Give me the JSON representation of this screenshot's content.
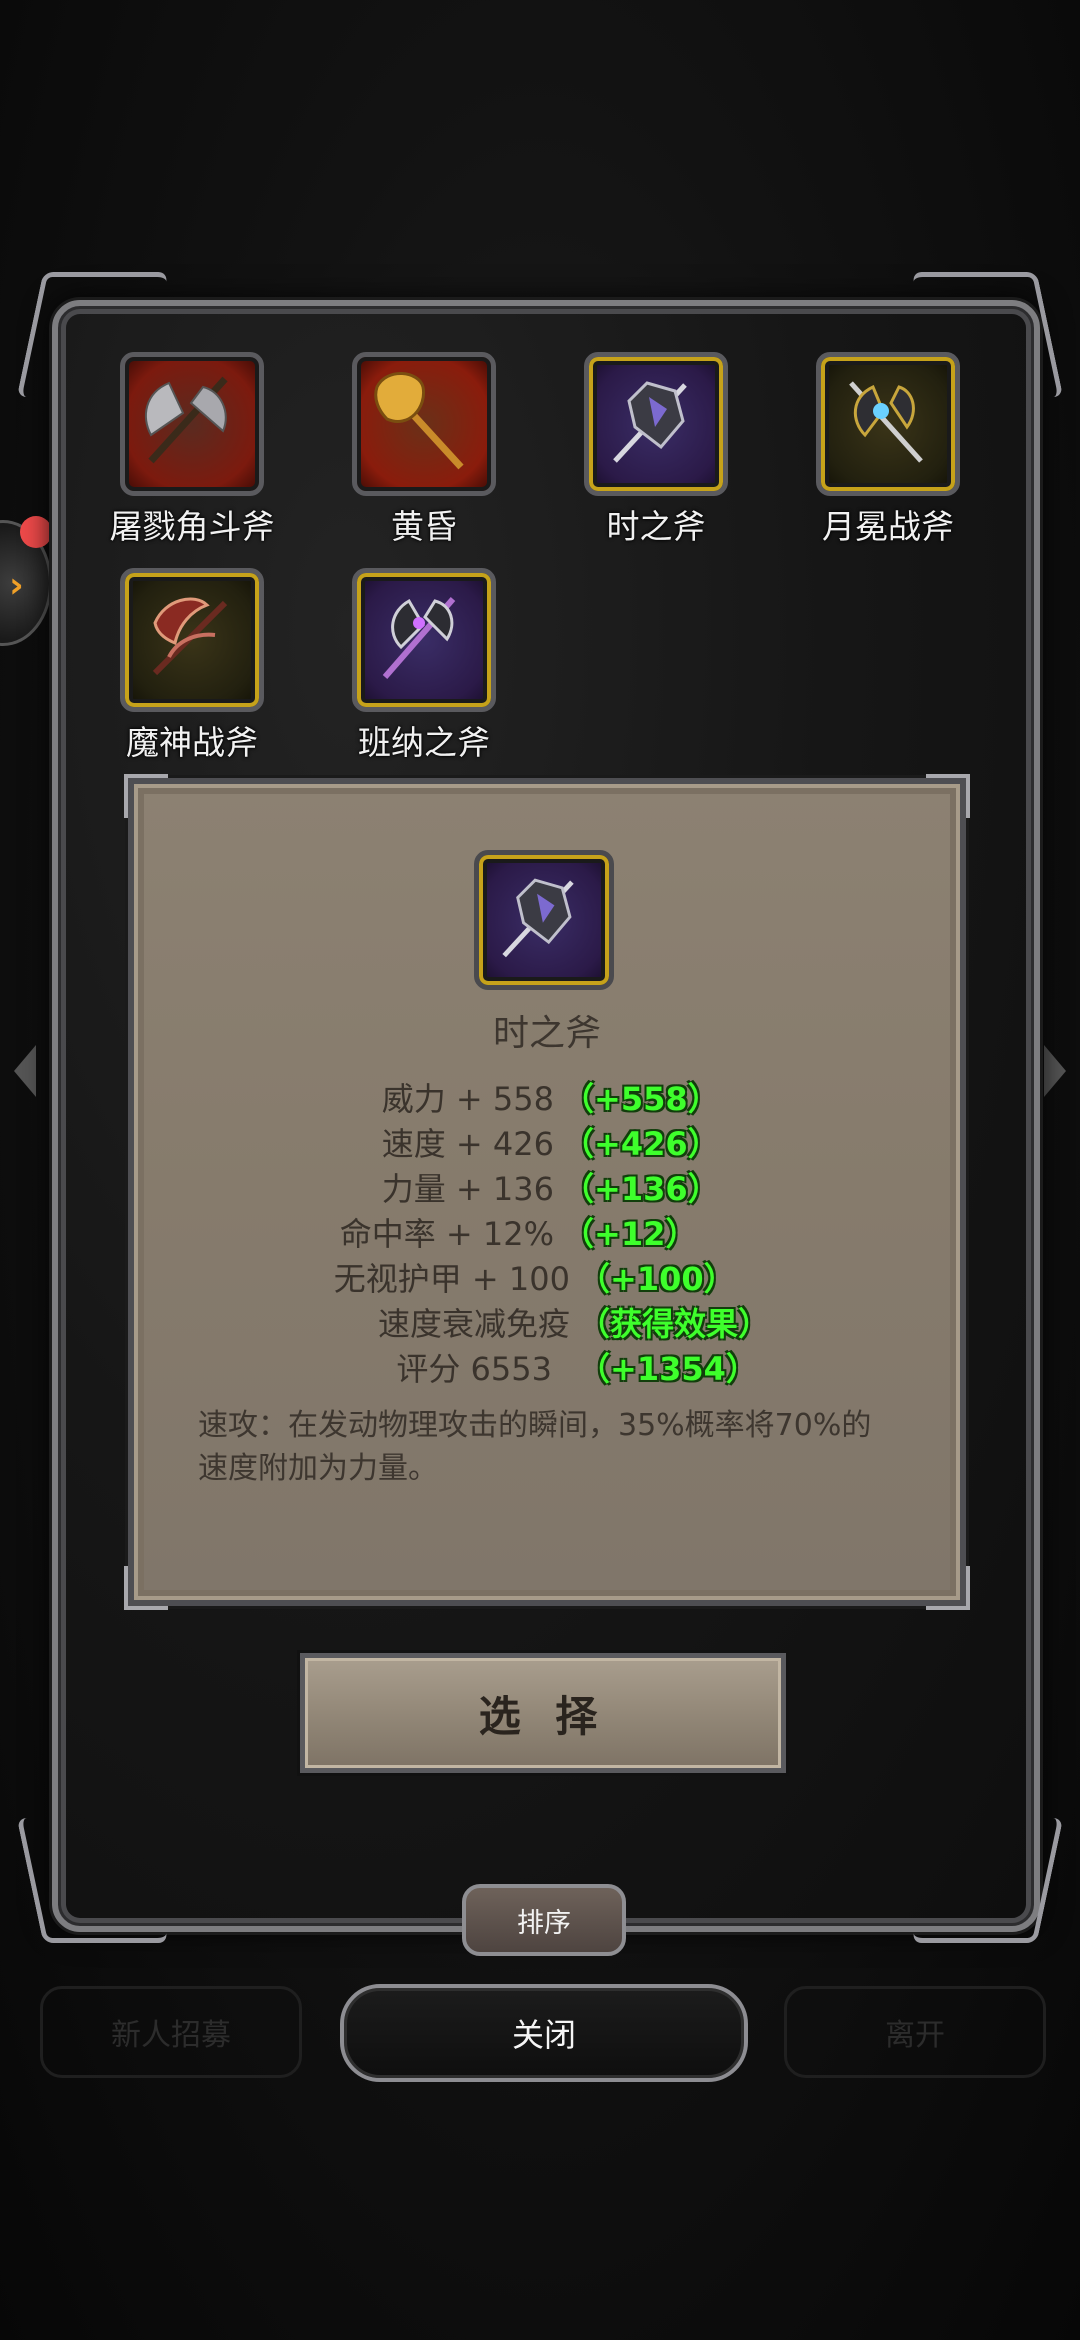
{
  "items": [
    {
      "label": "屠戮角斗斧",
      "icon": "double-axe-icon"
    },
    {
      "label": "黄昏",
      "icon": "golden-axe-icon"
    },
    {
      "label": "时之斧",
      "icon": "time-axe-icon"
    },
    {
      "label": "月冕战斧",
      "icon": "moon-battle-axe-icon"
    },
    {
      "label": "魔神战斧",
      "icon": "demon-battle-axe-icon"
    },
    {
      "label": "班纳之斧",
      "icon": "banner-axe-icon"
    }
  ],
  "detail": {
    "name": "时之斧",
    "stats": [
      {
        "label": "威力 + 558",
        "bonus": "（+558）"
      },
      {
        "label": "速度 + 426",
        "bonus": "（+426）"
      },
      {
        "label": "力量 + 136",
        "bonus": "（+136）"
      },
      {
        "label": "命中率 + 12%",
        "bonus": "（+12）"
      },
      {
        "label": "无视护甲 + 100",
        "bonus": "（+100）"
      },
      {
        "label": "速度衰减免疫",
        "bonus": "（获得效果）"
      },
      {
        "label": "评分 6553",
        "bonus": "（+1354）"
      }
    ],
    "description": "速攻：在发动物理攻击的瞬间，35%概率将70%的速度附加为力量。"
  },
  "buttons": {
    "select": "选 择",
    "sort": "排序",
    "close": "关闭"
  },
  "background_buttons": {
    "left": "新人招募",
    "right": "离开"
  },
  "colors": {
    "bonus_green": "#3eff2c",
    "panel_parchment": "#867b6c",
    "notification_red": "#ef4a4a"
  }
}
